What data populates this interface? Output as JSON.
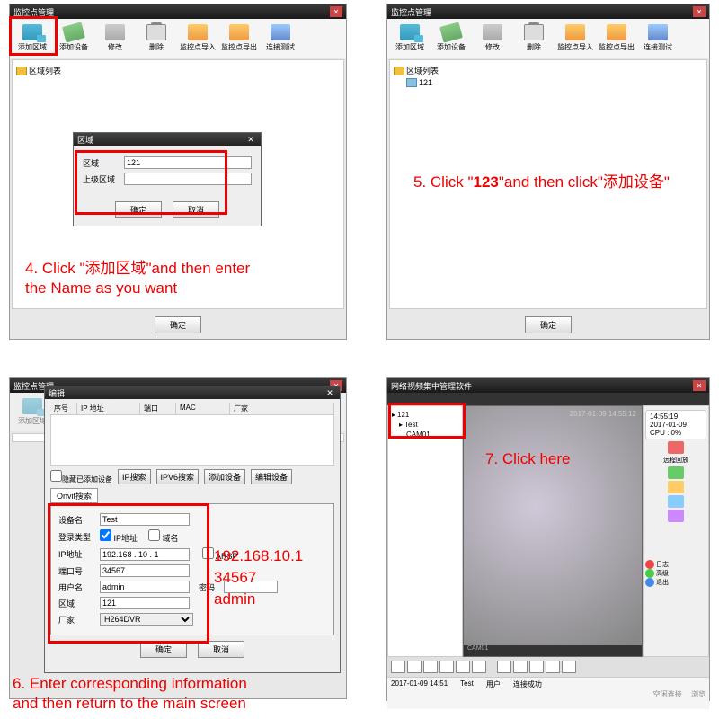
{
  "window_title": "监控点管理",
  "toolbar": {
    "add_area": "添加区域",
    "add_device": "添加设备",
    "modify": "修改",
    "delete": "删除",
    "import": "监控点导入",
    "export": "监控点导出",
    "test": "连接测试"
  },
  "tree": {
    "root": "区域列表",
    "node1": "121"
  },
  "btn_ok": "确定",
  "btn_cancel": "取消",
  "area_dialog": {
    "title": "区域",
    "lbl_area": "区域",
    "val_area": "121",
    "lbl_parent": "上级区域",
    "val_parent": ""
  },
  "dev_dialog": {
    "title": "编辑",
    "headers": {
      "seq": "序号",
      "ip": "IP 地址",
      "port": "端口",
      "mac": "MAC",
      "vendor": "厂家"
    },
    "chk_hide": "隐藏已添加设备",
    "btn_ipsearch": "IP搜索",
    "btn_ipv6": "IPV6搜索",
    "btn_adddev": "添加设备",
    "btn_editdev": "编辑设备",
    "tab_onvif": "Onvif搜索",
    "lbl_name": "设备名",
    "val_name": "Test",
    "lbl_logintype": "登录类型",
    "chk_ip": "IP地址",
    "chk_domain": "域名",
    "lbl_ip": "IP地址",
    "val_ip": "192.168 . 10 . 1",
    "chk_arsp": "ARSP",
    "lbl_port": "端口号",
    "val_port": "34567",
    "lbl_user": "用户名",
    "val_user": "admin",
    "lbl_pwd": "密码",
    "lbl_area": "区域",
    "val_area": "121",
    "lbl_vendor": "厂家",
    "val_vendor": "H264DVR"
  },
  "hints": {
    "ip": "192.168.10.1",
    "port": "34567",
    "user": "admin"
  },
  "player": {
    "title": "网络视频集中管理软件",
    "tree_root": "121",
    "tree_n1": "Test",
    "tree_n2": "CAM01",
    "status_date": "2017-01-09",
    "status_time": "14:55:19",
    "status_cpu": "CPU : 0%",
    "overlay": "2017-01-09 14:55:12",
    "r_label1": "远程回放",
    "r_label2": "日志",
    "r_label3": "高级",
    "r_label4": "退出",
    "bottom_date": "2017-01-09 14:51",
    "bottom_name": "Test",
    "bottom_status": "连接成功",
    "bottom_user": "用户",
    "footer1": "空闲连接",
    "footer2": "浏览",
    "tab_center": "CAM01"
  },
  "annotations": {
    "step4": "4. Click \"添加区域\"and then enter\n    the Name as you want",
    "step5": "5. Click \"123\"and then click\"添加设备\"",
    "step6": "6. Enter corresponding information\n    and then return to the main screen",
    "step7": "7. Click here"
  }
}
